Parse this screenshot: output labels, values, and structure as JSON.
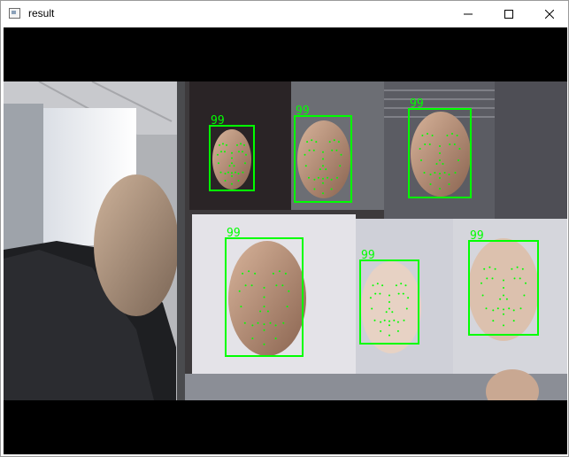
{
  "window": {
    "title": "result",
    "controls": {
      "minimize_icon": "minimize-icon",
      "maximize_icon": "maximize-icon",
      "close_icon": "close-icon"
    }
  },
  "view": {
    "detection_color": "#00ff00",
    "faces": [
      {
        "score": "99"
      },
      {
        "score": "99"
      },
      {
        "score": "99"
      },
      {
        "score": "99"
      },
      {
        "score": "99"
      },
      {
        "score": "99"
      }
    ]
  }
}
